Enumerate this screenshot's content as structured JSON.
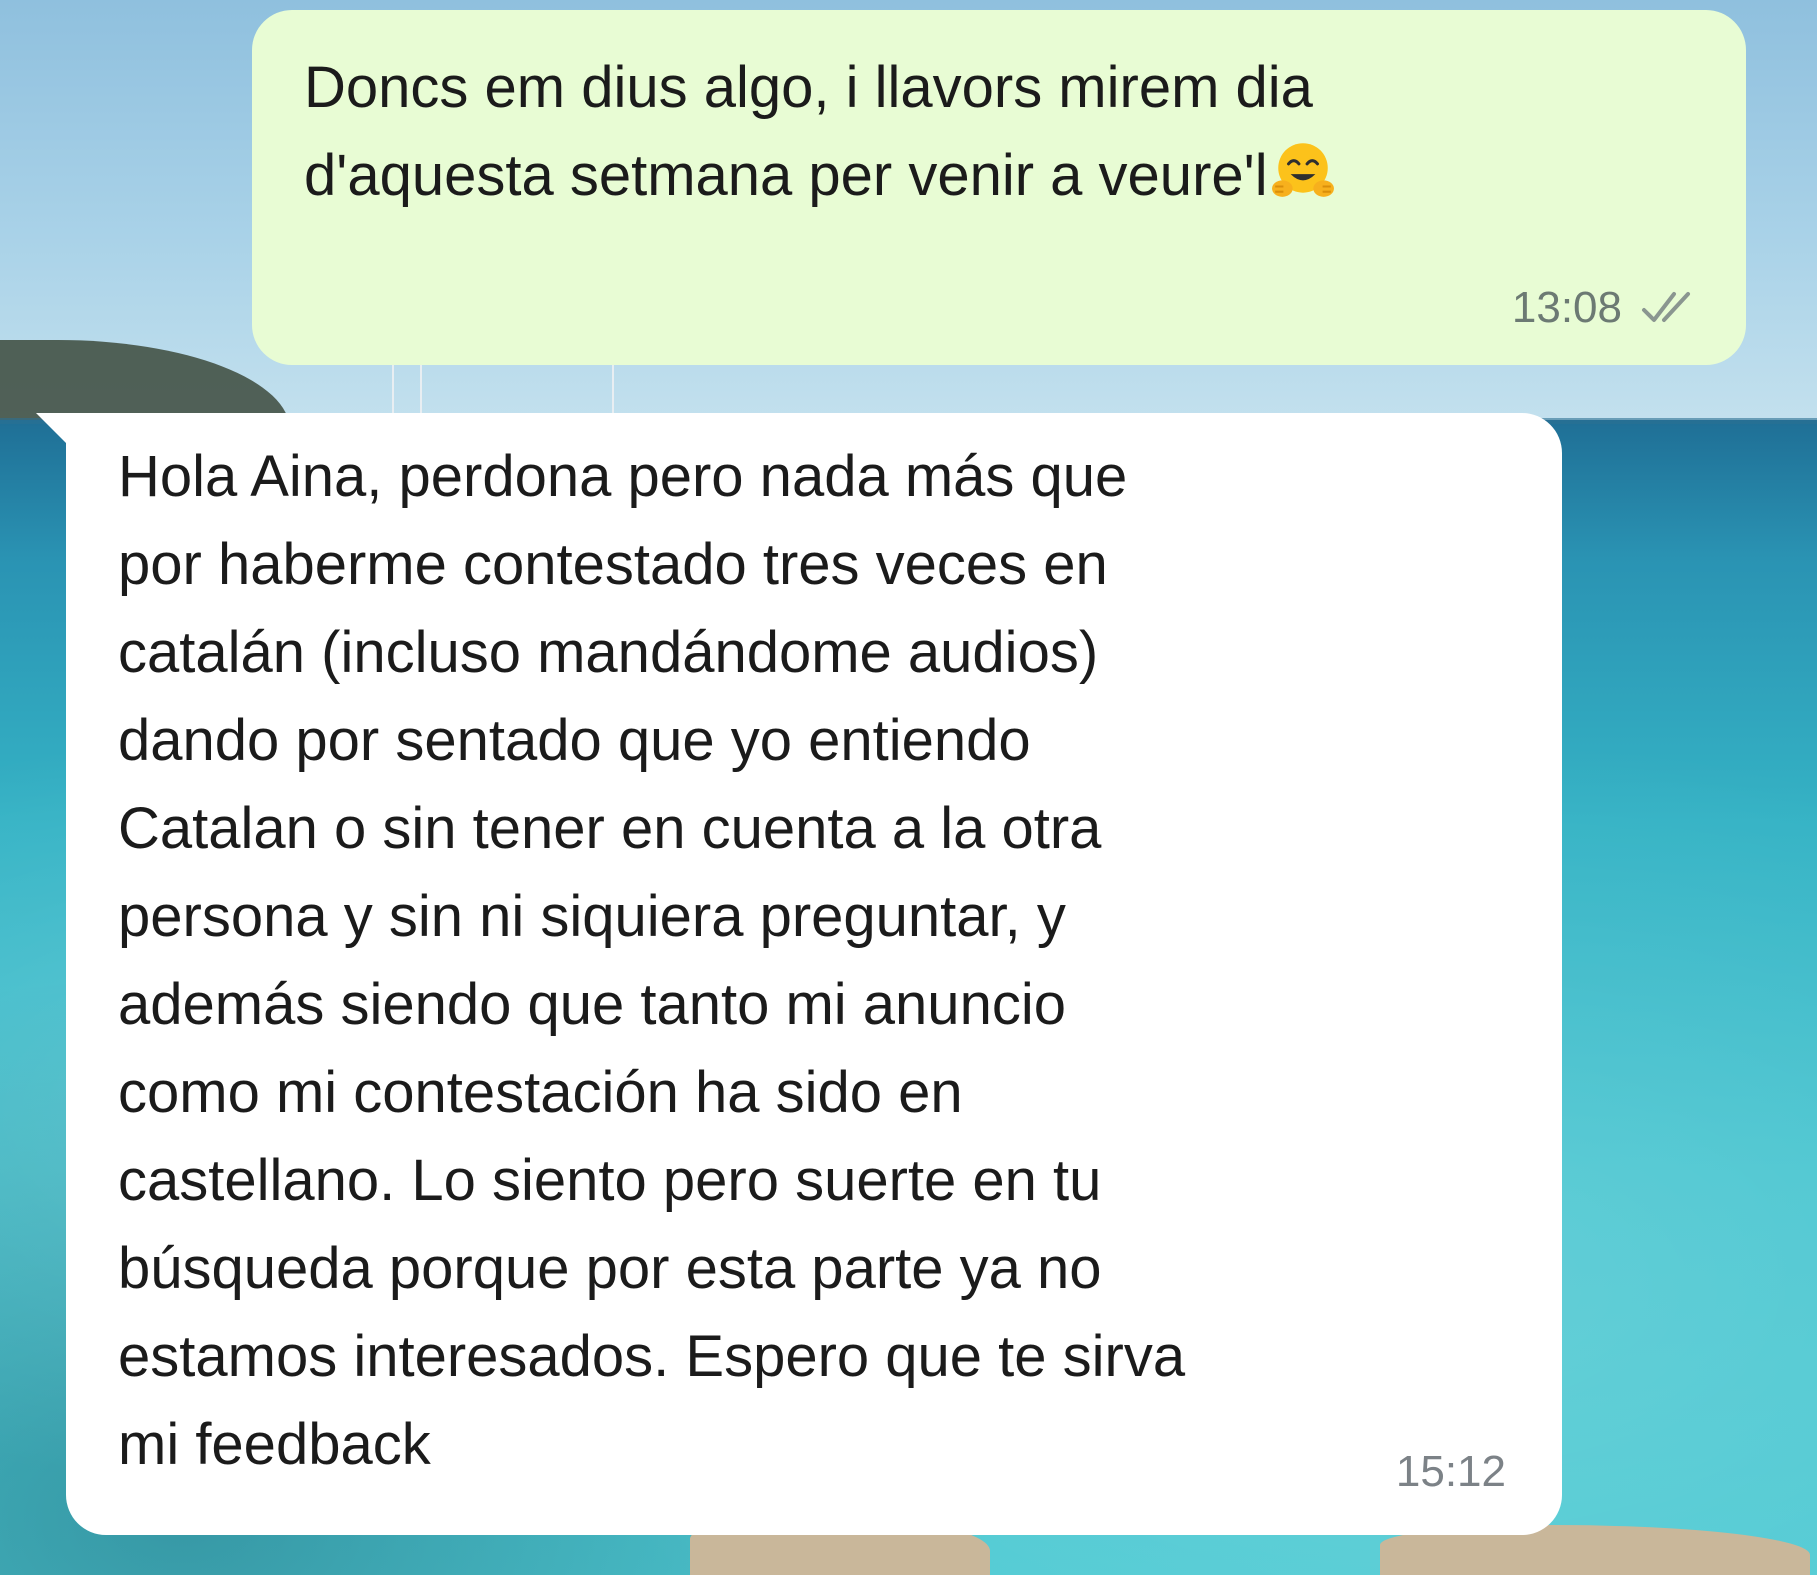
{
  "messages": [
    {
      "direction": "outgoing",
      "lines": [
        "Doncs em dius algo, i llavors mirem dia",
        "d'aquesta setmana per venir a veure'l"
      ],
      "emoji": "hugging-face-emoji",
      "time": "13:08",
      "status": "read-double-check"
    },
    {
      "direction": "incoming",
      "lines": [
        "Hola Aina, perdona pero nada más que",
        "por haberme contestado tres veces en",
        "catalán (incluso mandándome audios)",
        "dando por sentado que yo entiendo",
        "Catalan o sin tener en cuenta a la otra",
        "persona y sin ni siquiera preguntar, y",
        "además siendo que tanto mi anuncio",
        "como mi contestación ha sido en",
        "castellano. Lo siento pero suerte en tu",
        "búsqueda porque por esta parte ya no",
        "estamos interesados. Espero que te sirva",
        "mi feedback"
      ],
      "time": "15:12"
    }
  ],
  "colors": {
    "outgoing_bubble": "#e8fcd4",
    "incoming_bubble": "#ffffff",
    "text": "#1b1b1b",
    "meta_text": "#6c7a73",
    "check_marks": "#8a9690"
  }
}
